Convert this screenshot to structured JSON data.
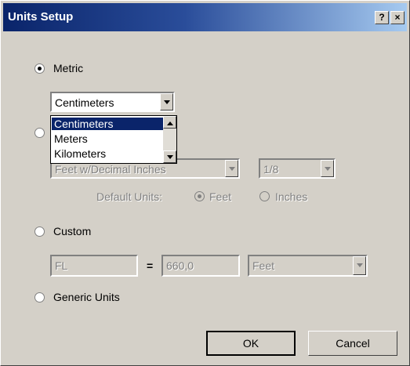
{
  "window": {
    "title": "Units Setup",
    "help_label": "?",
    "close_label": "×"
  },
  "options": {
    "metric": {
      "label": "Metric",
      "selected": true
    },
    "custom": {
      "label": "Custom",
      "selected": false
    },
    "generic": {
      "label": "Generic Units",
      "selected": false
    }
  },
  "metric_unit": {
    "value": "Centimeters",
    "dropdown_items": [
      "Centimeters",
      "Meters",
      "Kilometers"
    ],
    "highlighted": "Centimeters"
  },
  "us_units": {
    "format_value": "Feet w/Decimal Inches",
    "fraction_value": "1/8",
    "default_units_label": "Default Units:",
    "feet_label": "Feet",
    "inches_label": "Inches",
    "default_selected": "Feet"
  },
  "custom_unit": {
    "name_value": "FL",
    "equals": "=",
    "amount_value": "660,0",
    "unit_value": "Feet"
  },
  "buttons": {
    "ok": "OK",
    "cancel": "Cancel"
  }
}
